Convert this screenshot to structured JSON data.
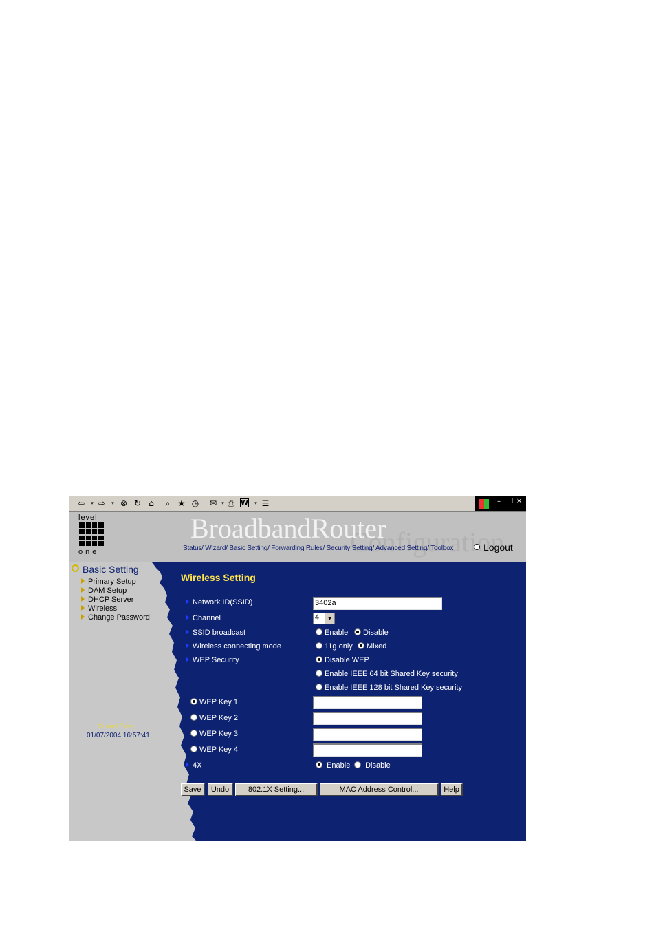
{
  "toolbar": {
    "icons": [
      "back-icon",
      "dropdown-icon",
      "forward-icon",
      "dropdown-icon",
      "stop-icon",
      "refresh-icon",
      "home-icon",
      "search-icon",
      "favorites-icon",
      "history-icon",
      "mail-icon",
      "dropdown-icon",
      "print-icon",
      "edit-icon",
      "dropdown-icon",
      "discuss-icon"
    ]
  },
  "header": {
    "logo_top": "level",
    "logo_bottom": "one",
    "brand": "BroadbandRouter",
    "brand_sub": "Configuration",
    "nav": "Status/ Wizard/ Basic Setting/ Forwarding Rules/ Security Setting/ Advanced Setting/ Toolbox",
    "logout": "Logout"
  },
  "sidebar": {
    "section": "Basic Setting",
    "items": [
      {
        "label": "Primary Setup"
      },
      {
        "label": "DAM Setup"
      },
      {
        "label": "DHCP Server"
      },
      {
        "label": "Wireless"
      },
      {
        "label": "Change Password"
      }
    ],
    "current_time_label": "Current Time",
    "current_time": "01/07/2004 16:57:41"
  },
  "form": {
    "title": "Wireless Setting",
    "ssid_label": "Network ID(SSID)",
    "ssid_value": "3402a",
    "channel_label": "Channel",
    "channel_value": "4",
    "ssid_broadcast_label": "SSID broadcast",
    "ssid_broadcast_options": [
      "Enable",
      "Disable"
    ],
    "ssid_broadcast_selected": "Disable",
    "mode_label": "Wireless connecting mode",
    "mode_options": [
      "11g only",
      "Mixed"
    ],
    "mode_selected": "Mixed",
    "wep_label": "WEP Security",
    "wep_options": [
      "Disable WEP",
      "Enable IEEE 64 bit Shared Key security",
      "Enable IEEE 128 bit Shared Key security"
    ],
    "wep_selected": "Disable WEP",
    "wep_keys": [
      {
        "label": "WEP Key 1",
        "value": ""
      },
      {
        "label": "WEP Key 2",
        "value": ""
      },
      {
        "label": "WEP Key 3",
        "value": ""
      },
      {
        "label": "WEP Key 4",
        "value": ""
      }
    ],
    "wep_key_selected": "WEP Key 1",
    "fourx_label": "4X",
    "fourx_options": [
      "Enable",
      "Disable"
    ],
    "fourx_selected": "Enable",
    "buttons": {
      "save": "Save",
      "undo": "Undo",
      "dot1x": "802.1X Setting...",
      "mac": "MAC Address Control...",
      "help": "Help"
    }
  },
  "colors": {
    "main_bg": "#0d2270",
    "side_bg": "#c8c8c8",
    "title": "#ffe44d",
    "label": "#ffffff"
  }
}
